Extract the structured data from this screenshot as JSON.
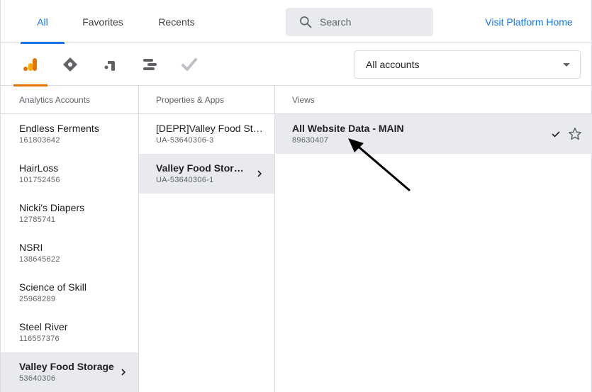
{
  "tabs": [
    {
      "label": "All",
      "active": true
    },
    {
      "label": "Favorites",
      "active": false
    },
    {
      "label": "Recents",
      "active": false
    }
  ],
  "search": {
    "placeholder": "Search"
  },
  "visit_link": "Visit Platform Home",
  "product_icons": [
    "analytics-icon",
    "tag-manager-icon",
    "optimize-icon",
    "data-studio-icon",
    "surveys-icon"
  ],
  "account_select": {
    "value": "All accounts"
  },
  "columns": {
    "accounts": "Analytics Accounts",
    "properties": "Properties & Apps",
    "views": "Views"
  },
  "accounts": [
    {
      "name": "Endless Ferments",
      "id": "161803642"
    },
    {
      "name": "HairLoss",
      "id": "101752456"
    },
    {
      "name": "Nicki's Diapers",
      "id": "12785741"
    },
    {
      "name": "NSRI",
      "id": "138645622"
    },
    {
      "name": "Science of Skill",
      "id": "25968289"
    },
    {
      "name": "Steel River",
      "id": "116557376"
    },
    {
      "name": "Valley Food Storage",
      "id": "53640306",
      "selected": true
    }
  ],
  "properties": [
    {
      "name": "[DEPR]Valley Food Storage",
      "id": "UA-53640306-3"
    },
    {
      "name": "Valley Food Storage",
      "id": "UA-53640306-1",
      "selected": true
    }
  ],
  "views": [
    {
      "name": "All Website Data - MAIN",
      "id": "89630407",
      "selected": true
    }
  ],
  "colors": {
    "accent": "#1a73e8",
    "analytics": "#e37400",
    "selected_bg": "#e8eaed"
  }
}
